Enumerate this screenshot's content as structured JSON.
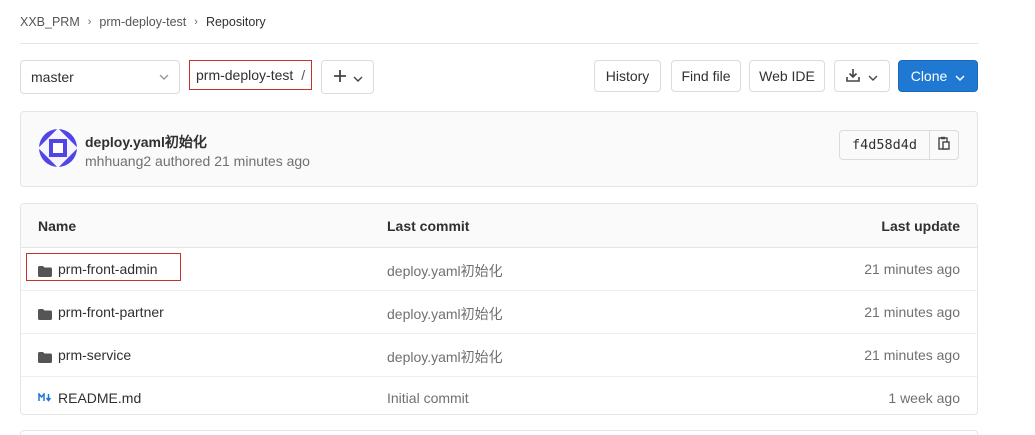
{
  "breadcrumb": {
    "items": [
      "XXB_PRM",
      "prm-deploy-test",
      "Repository"
    ]
  },
  "toolbar": {
    "branch": "master",
    "path_project": "prm-deploy-test",
    "path_sep": "/",
    "history_label": "History",
    "find_file_label": "Find file",
    "web_ide_label": "Web IDE",
    "clone_label": "Clone"
  },
  "last_commit": {
    "title": "deploy.yaml初始化",
    "meta": "mhhuang2 authored 21 minutes ago",
    "sha": "f4d58d4d"
  },
  "tree": {
    "headers": {
      "name": "Name",
      "last_commit": "Last commit",
      "last_update": "Last update"
    },
    "rows": [
      {
        "icon": "folder-icon",
        "name": "prm-front-admin",
        "commit": "deploy.yaml初始化",
        "updated": "21 minutes ago"
      },
      {
        "icon": "folder-icon",
        "name": "prm-front-partner",
        "commit": "deploy.yaml初始化",
        "updated": "21 minutes ago"
      },
      {
        "icon": "folder-icon",
        "name": "prm-service",
        "commit": "deploy.yaml初始化",
        "updated": "21 minutes ago"
      },
      {
        "icon": "markdown-icon",
        "name": "README.md",
        "commit": "Initial commit",
        "updated": "1 week ago"
      }
    ]
  },
  "colors": {
    "accent": "#1f78d1",
    "highlight_border": "#c9302c",
    "avatar": "#4f46e5"
  }
}
